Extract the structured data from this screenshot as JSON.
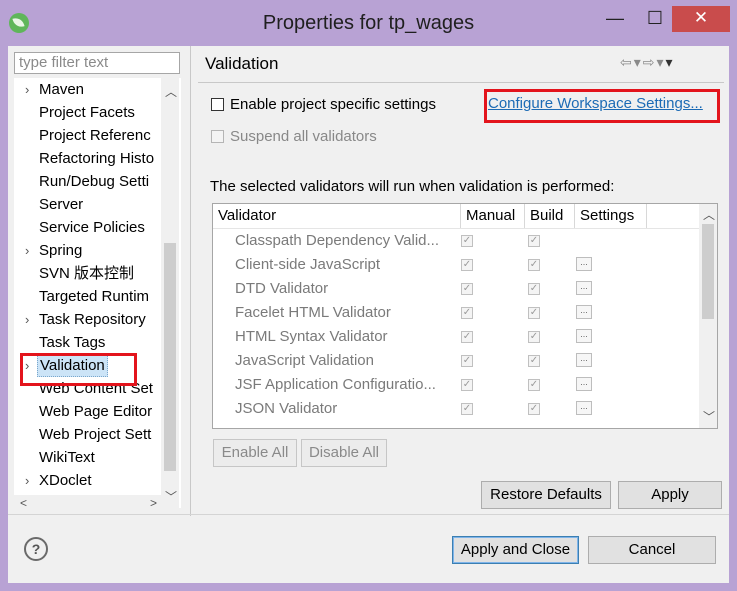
{
  "window": {
    "title": "Properties for tp_wages",
    "minimize_glyph": "—",
    "maximize_glyph": "☐",
    "close_glyph": "✕"
  },
  "sidebar": {
    "filter_placeholder": "type filter text",
    "items": [
      {
        "label": "Maven",
        "expandable": true
      },
      {
        "label": "Project Facets",
        "expandable": false
      },
      {
        "label": "Project Referenc",
        "expandable": false
      },
      {
        "label": "Refactoring Histo",
        "expandable": false
      },
      {
        "label": "Run/Debug Setti",
        "expandable": false
      },
      {
        "label": "Server",
        "expandable": false
      },
      {
        "label": "Service Policies",
        "expandable": false
      },
      {
        "label": "Spring",
        "expandable": true
      },
      {
        "label": "SVN 版本控制",
        "expandable": false
      },
      {
        "label": "Targeted Runtim",
        "expandable": false
      },
      {
        "label": "Task Repository",
        "expandable": true
      },
      {
        "label": "Task Tags",
        "expandable": false
      },
      {
        "label": "Validation",
        "expandable": true,
        "selected": true
      },
      {
        "label": "Web Content Set",
        "expandable": false
      },
      {
        "label": "Web Page Editor",
        "expandable": false
      },
      {
        "label": "Web Project Sett",
        "expandable": false
      },
      {
        "label": "WikiText",
        "expandable": false
      },
      {
        "label": "XDoclet",
        "expandable": true
      }
    ]
  },
  "main": {
    "heading": "Validation",
    "enable_project_settings": {
      "label": "Enable project specific settings",
      "checked": false
    },
    "configure_link": "Configure Workspace Settings...",
    "suspend_validators": {
      "label": "Suspend all validators",
      "checked": false,
      "disabled": true
    },
    "description": "The selected validators will run when validation is performed:",
    "table": {
      "columns": [
        "Validator",
        "Manual",
        "Build",
        "Settings"
      ],
      "rows": [
        {
          "name": "Classpath Dependency Valid...",
          "manual": true,
          "build": true,
          "settings": false
        },
        {
          "name": "Client-side JavaScript",
          "manual": true,
          "build": true,
          "settings": true
        },
        {
          "name": "DTD Validator",
          "manual": true,
          "build": true,
          "settings": true
        },
        {
          "name": "Facelet HTML Validator",
          "manual": true,
          "build": true,
          "settings": true
        },
        {
          "name": "HTML Syntax Validator",
          "manual": true,
          "build": true,
          "settings": true
        },
        {
          "name": "JavaScript Validation",
          "manual": true,
          "build": true,
          "settings": true
        },
        {
          "name": "JSF Application Configuratio...",
          "manual": true,
          "build": true,
          "settings": true
        },
        {
          "name": "JSON Validator",
          "manual": true,
          "build": true,
          "settings": true
        }
      ]
    },
    "enable_all": "Enable All",
    "disable_all": "Disable All",
    "restore_defaults": "Restore Defaults",
    "apply": "Apply"
  },
  "footer": {
    "help_glyph": "?",
    "apply_and_close": "Apply and Close",
    "cancel": "Cancel"
  },
  "colors": {
    "titlebar": "#b8a2d4",
    "close_button": "#c94c4c",
    "highlight_box": "#e3141c",
    "link": "#1c6bb5"
  }
}
